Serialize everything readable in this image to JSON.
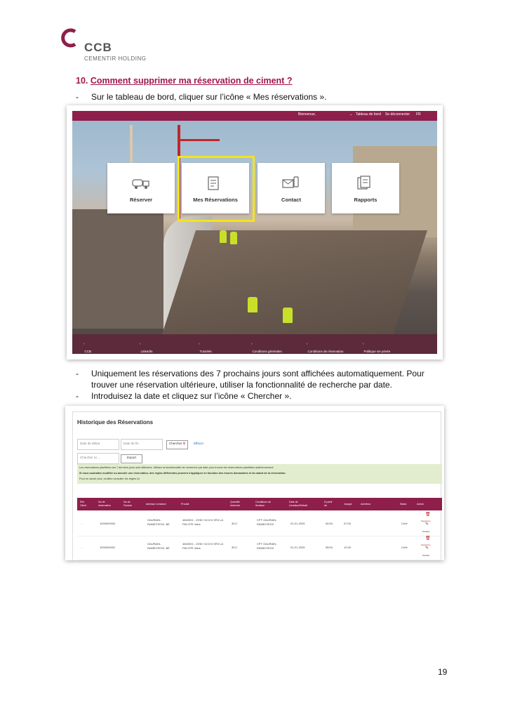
{
  "logo": {
    "name": "CCB",
    "subtitle": "CEMENTIR HOLDING"
  },
  "section": {
    "number": "10.",
    "title": "Comment supprimer ma réservation de ciment ?"
  },
  "bullets": [
    "Sur le tableau de bord, cliquer sur l’icône « Mes réservations ».",
    "Uniquement les réservations des 7 prochains jours sont affichées automatiquement. Pour trouver une réservation ultérieure, utiliser la fonctionnalité de recherche par date.",
    "Introduisez la date et cliquez sur l’icône « Chercher »."
  ],
  "dashboard": {
    "topbar": {
      "welcome": "Bienvenue,",
      "dashboard": "Tableau de bord",
      "logout": "Se déconnecter",
      "lang": "FR"
    },
    "cards": [
      "Réserver",
      "Mes Réservations",
      "Contact",
      "Rapports"
    ],
    "footer": [
      "CCB",
      "LinkedIn",
      "Tutoriels",
      "Conditions générales",
      "Conditions de réservation",
      "Politique vie privée"
    ]
  },
  "history": {
    "title": "Historique des Réservations",
    "date_from_placeholder": "Date de début",
    "date_to_placeholder": "Date de fin",
    "search_label": "Chercher",
    "clear_label": "Effacer",
    "search_input_placeholder": "Chercher ici ...",
    "export_label": "Export",
    "notice": [
      "Les réservations planifiées ces 7 derniers jours sont affichées. Utilisez la fonctionnalité de recherche par date pour trouver les réservations planifiées antérieurement.",
      "Si vous souhaitez modifier ou annuler une réservation, des règles différentes peuvent s’appliquer en fonction des heures demandées et du statut de la réservation.",
      "Pour en savoir plus, veuillez consulter les règles ici."
    ],
    "columns": [
      "Réf. Client",
      "No de réservation",
      "No de Facture",
      "Adresse Livraison",
      "Produit",
      "Quantité réservée",
      "Conditions de livraison",
      "Date de Livraison/Retrait",
      "À partir de",
      "Jusque",
      "Acheteur",
      "Statut",
      "Action"
    ],
    "rows": [
      {
        "ref": "-",
        "booking": "1000000000",
        "address": "GAURAIN-RAMECROIX, BE",
        "product": "4840001 - CEM I 52,5 N SR3 LA PM-CPE /silos",
        "qty": "30.0",
        "cond": "CPT GAURAIN-RAMECROIX",
        "date": "01-01-2025",
        "from": "06:00",
        "to": "07:00",
        "status": "Créé",
        "delete": "Supprimer",
        "edit": "Modifier"
      },
      {
        "ref": "-",
        "booking": "1000000002",
        "address": "GAURAIN-RAMECROIX, BE",
        "product": "4840001 - CEM I 52,5 N SR3 LA PM-CPE /silos",
        "qty": "30.0",
        "cond": "CPT GAURAIN-RAMECROIX",
        "date": "01-01-2025",
        "from": "08:00",
        "to": "12:00",
        "status": "Créé",
        "delete": "Supprimer",
        "edit": "Modifier"
      }
    ]
  },
  "page_number": "19"
}
